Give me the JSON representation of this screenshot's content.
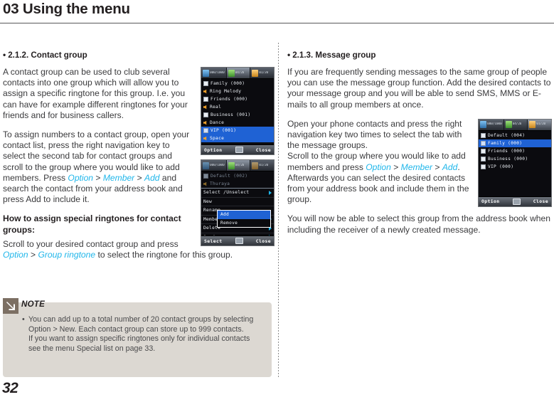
{
  "header": {
    "chapter_title": "03 Using the menu"
  },
  "left_column": {
    "section": {
      "bullet": "•",
      "heading": "2.1.2. Contact group"
    },
    "paragraph_1": "A contact group can be used to club several contacts into one group which will allow you to assign a specific ringtone for this group. I.e. you can have for example different ringtones for your friends and for business callers.",
    "paragraph_2_part_1": "To assign numbers to a contact group, open your contact list, press the right navigation key to select the second tab for contact groups and scroll to the group where you would like to add members. Press ",
    "paragraph_2_hl_1": "Option",
    "paragraph_2_sep_1": " > ",
    "paragraph_2_hl_2": "Member",
    "paragraph_2_sep_2": " > ",
    "paragraph_2_hl_3": "Add",
    "paragraph_2_part_2": " and search the contact from your address book and press Add to include it.",
    "sub_heading": "How to assign special ringtones for contact groups:",
    "paragraph_3_part_1": "Scroll to your desired contact group and press ",
    "paragraph_3_hl_1": "Option",
    "paragraph_3_sep_1": " > ",
    "paragraph_3_hl_2": "Group ringtone",
    "paragraph_3_part_2": " to select the ringtone for this group."
  },
  "right_column": {
    "section": {
      "bullet": "•",
      "heading": "2.1.3. Message group"
    },
    "paragraph_1": "If you are frequently sending messages to the same group of people you can use the message group function. Add the desired contacts to your message group and you will be able to send SMS, MMS or E-mails to all group members at once.",
    "paragraph_2_part_1": "Open your phone contacts and press the right navigation key two times to select the tab with the message groups.",
    "paragraph_2_part_2": "Scroll to the group where you would like to add members and press ",
    "paragraph_2_hl_1": "Option",
    "paragraph_2_sep_1": " > ",
    "paragraph_2_hl_2": "Member",
    "paragraph_2_sep_2": " > ",
    "paragraph_2_hl_3": "Add",
    "paragraph_2_part_3": ". Afterwards you can select the desired contacts from your address book and include them in the group.",
    "paragraph_3": "You will now be able to select this group from the address book when including the receiver of a newly created message."
  },
  "note": {
    "label": "NOTE",
    "icon": "arrow-down-right-icon",
    "line_1": "You can add up to a total number of 20 contact groups by selecting Option > New. Each contact group can store up to 999 contacts.",
    "line_2": "If you want to assign specific ringtones only for individual contacts see the menu Special list on page 33."
  },
  "page_number": "32",
  "phone_screens": {
    "contact_groups": {
      "tabs": [
        {
          "icon": "person-icon",
          "count": "000/1000",
          "selected": false
        },
        {
          "icon": "group-icon",
          "count": "04/20",
          "selected": true
        },
        {
          "icon": "mail-icon",
          "count": "01/20",
          "selected": false
        }
      ],
      "rows": [
        {
          "label": "Family  (000)",
          "type": "group",
          "selected": false
        },
        {
          "label": "Ring Melody",
          "type": "tone",
          "selected": false
        },
        {
          "label": "Friends  (000)",
          "type": "group",
          "selected": false
        },
        {
          "label": "Real",
          "type": "tone",
          "selected": false
        },
        {
          "label": "Business  (001)",
          "type": "group",
          "selected": false
        },
        {
          "label": "Dance",
          "type": "tone",
          "selected": false
        },
        {
          "label": "VIP  (001)",
          "type": "group",
          "selected": true
        },
        {
          "label": "Space",
          "type": "tone",
          "selected": true
        }
      ],
      "softkeys": {
        "left": "Option",
        "middle": "screen-icon",
        "right": "Close"
      }
    },
    "option_menu": {
      "tabs": [
        {
          "icon": "person-icon",
          "count": "000/1000",
          "selected": false
        },
        {
          "icon": "group-icon",
          "count": "04/20",
          "selected": true
        },
        {
          "icon": "mail-icon",
          "count": "01/20",
          "selected": false
        }
      ],
      "rows": [
        {
          "label": "Default  (002)",
          "type": "group"
        },
        {
          "label": "Thuraya",
          "type": "tone"
        }
      ],
      "menu_items": [
        {
          "label": "Select /Unselect",
          "submenu": true
        },
        {
          "label": "New",
          "submenu": false
        },
        {
          "label": "Rename",
          "submenu": false
        },
        {
          "label": "Member",
          "submenu": true
        },
        {
          "label": "Delete",
          "submenu": true
        },
        {
          "label": "Send message",
          "submenu": true
        }
      ],
      "submenu_items": [
        {
          "label": "Add",
          "selected": true
        },
        {
          "label": "Remove",
          "selected": false
        }
      ],
      "softkeys": {
        "left": "Select",
        "middle": "envelope-icon",
        "right": "Close"
      }
    },
    "message_groups": {
      "tabs": [
        {
          "icon": "person-icon",
          "count": "000/1000",
          "selected": false
        },
        {
          "icon": "group-icon",
          "count": "04/20",
          "selected": false
        },
        {
          "icon": "mail-icon",
          "count": "01/20",
          "selected": true
        }
      ],
      "rows": [
        {
          "label": "Default  (004)",
          "type": "group",
          "selected": false
        },
        {
          "label": "Family  (000)",
          "type": "group",
          "selected": true
        },
        {
          "label": "Friends  (000)",
          "type": "group",
          "selected": false
        },
        {
          "label": "Business  (000)",
          "type": "group",
          "selected": false
        },
        {
          "label": "VIP  (000)",
          "type": "group",
          "selected": false
        }
      ],
      "softkeys": {
        "left": "Option",
        "middle": "screen-icon",
        "right": "Close"
      }
    }
  },
  "colors": {
    "highlight_text": "#1fb6ea",
    "note_background": "#dcd8d2",
    "note_icon": "#7c6f63",
    "phone_selection": "#1f62d4"
  }
}
